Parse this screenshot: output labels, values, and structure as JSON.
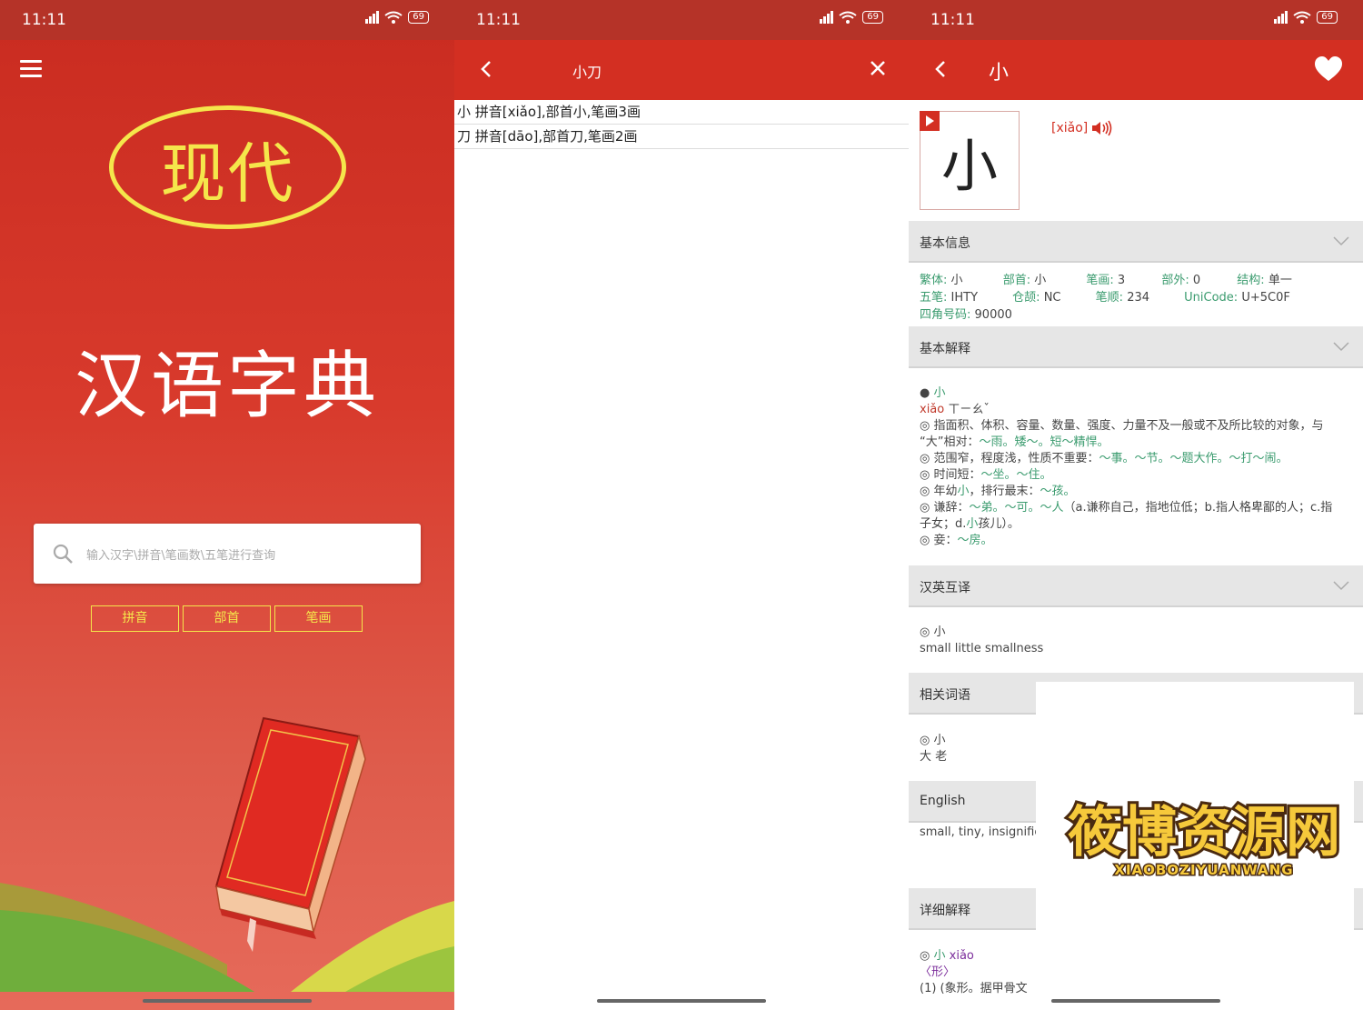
{
  "status": {
    "time": "11:11",
    "battery": "69"
  },
  "home": {
    "logo_text": "现代",
    "app_title": "汉语字典",
    "search_placeholder": "输入汉字\\拼音\\笔画数\\五笔进行查询",
    "buttons": [
      "拼音",
      "部首",
      "笔画"
    ]
  },
  "search": {
    "query": "小刀",
    "results": [
      "小 拼音[xiǎo],部首小,笔画3画",
      "刀 拼音[dāo],部首刀,笔画2画"
    ]
  },
  "detail": {
    "title": "小",
    "character": "小",
    "pinyin": "[xiǎo]",
    "sections": {
      "basic_info": "基本信息",
      "basic_explain": "基本解释",
      "translate": "汉英互译",
      "related": "相关词语",
      "english": "English",
      "detail_explain": "详细解释"
    },
    "info": {
      "fanti_k": "繁体:",
      "fanti_v": "小",
      "bushou_k": "部首:",
      "bushou_v": "小",
      "bihua_k": "笔画:",
      "bihua_v": "3",
      "buwai_k": "部外:",
      "buwai_v": "0",
      "jiegou_k": "结构:",
      "jiegou_v": "单一",
      "wubi_k": "五笔:",
      "wubi_v": "IHTY",
      "cangjie_k": "仓颉:",
      "cangjie_v": "NC",
      "bishun_k": "笔顺:",
      "bishun_v": "234",
      "unicode_k": "UniCode:",
      "unicode_v": "U+5C0F",
      "sijiao_k": "四角号码:",
      "sijiao_v": "90000"
    },
    "explain": {
      "head": "小",
      "pinyin": "xiǎo",
      "zhuyin": "ㄒㄧㄠˇ",
      "l1a": "◎ 指面积、体积、容量、数量、强度、力量不及一般或不及所比较的对象，与",
      "l1b": "“大”相对：",
      "l1c": "～雨。矮～。短～精悍。",
      "l2a": "◎ 范围窄，程度浅，性质不重要：",
      "l2b": "～事。～节。～题大作。～打～闹。",
      "l3a": "◎ 时间短：",
      "l3b": "～坐。～住。",
      "l4a": "◎ 年幼",
      "l4b": "小",
      "l4c": "，排行最末：",
      "l4d": "～孩。",
      "l5a": "◎ 谦辞：",
      "l5b": "～弟。～可。～人",
      "l5c": "（a.谦称自己，指地位低；b.指人格卑鄙的人；c.指",
      "l5d": "子女；d.",
      "l5e": "小",
      "l5f": "孩儿）。",
      "l6a": "◎ 妾：",
      "l6b": "～房。"
    },
    "translate": {
      "head": "◎  小",
      "text": "small little smallness"
    },
    "related": {
      "head": "◎ 小",
      "text": "大 老"
    },
    "english_text": "small, tiny, insignifica",
    "detail": {
      "head_a": "◎ ",
      "head_b": "小",
      "head_c": " xiǎo",
      "line2": "〈形〉",
      "line3": "(1) (象形。据甲骨文"
    }
  },
  "watermark": {
    "main": "筱博资源网",
    "sub": "XIAOBOZIYUANWANG"
  },
  "colors": {
    "primary": "#d32f22",
    "statusbar": "#b53328",
    "accent_yellow": "#f5e64b",
    "green_text": "#3a9b6e"
  }
}
